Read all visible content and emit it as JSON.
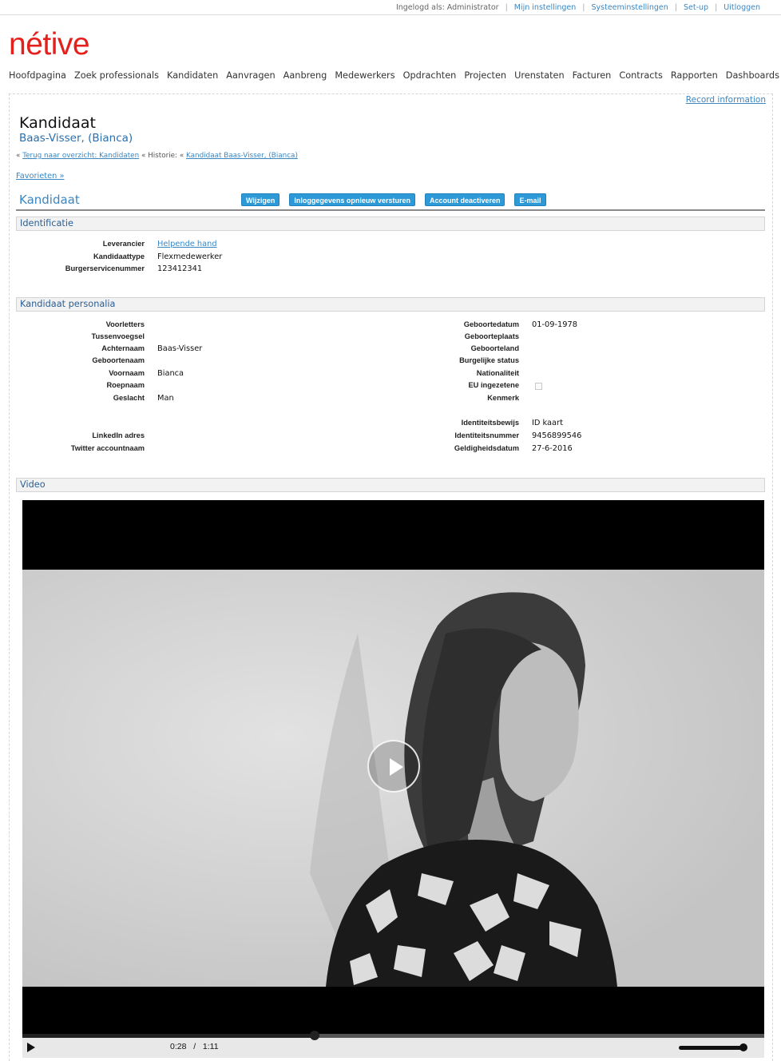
{
  "topbar": {
    "login_text": "Ingelogd als: Administrator",
    "links": [
      "Mijn instellingen",
      "Systeeminstellingen",
      "Set-up",
      "Uitloggen"
    ]
  },
  "logo": "nétive",
  "nav": [
    "Hoofdpagina",
    "Zoek professionals",
    "Kandidaten",
    "Aanvragen",
    "Aanbreng",
    "Medewerkers",
    "Opdrachten",
    "Projecten",
    "Urenstaten",
    "Facturen",
    "Contracts",
    "Rapporten",
    "Dashboards"
  ],
  "record_information": "Record information",
  "page": {
    "title": "Kandidaat",
    "subtitle": "Baas-Visser, (Bianca)"
  },
  "breadcrumb": {
    "prefix": "«",
    "back_link": "Terug naar overzicht: Kandidaten",
    "middle": "« Historie: «",
    "history_link": "Kandidaat Baas-Visser, (Bianca)"
  },
  "favorites": "Favorieten »",
  "section": {
    "title": "Kandidaat",
    "buttons": [
      "Wijzigen",
      "Inloggegevens opnieuw versturen",
      "Account deactiveren",
      "E-mail"
    ]
  },
  "identificatie": {
    "title": "Identificatie",
    "fields": [
      {
        "label": "Leverancier",
        "value": "Helpende hand"
      },
      {
        "label": "Kandidaattype",
        "value": "Flexmedewerker"
      },
      {
        "label": "Burgerservicenummer",
        "value": "123412341"
      }
    ]
  },
  "personalia": {
    "title": "Kandidaat personalia",
    "left": [
      {
        "label": "Voorletters",
        "value": ""
      },
      {
        "label": "Tussenvoegsel",
        "value": ""
      },
      {
        "label": "Achternaam",
        "value": "Baas-Visser"
      },
      {
        "label": "Geboortenaam",
        "value": ""
      },
      {
        "label": "Voornaam",
        "value": "Bianca"
      },
      {
        "label": "Roepnaam",
        "value": ""
      },
      {
        "label": "Geslacht",
        "value": "Man"
      },
      {
        "label": "LinkedIn adres",
        "value": ""
      },
      {
        "label": "Twitter accountnaam",
        "value": ""
      }
    ],
    "right": [
      {
        "label": "Geboortedatum",
        "value": "01-09-1978"
      },
      {
        "label": "Geboorteplaats",
        "value": ""
      },
      {
        "label": "Geboorteland",
        "value": ""
      },
      {
        "label": "Burgelijke status",
        "value": ""
      },
      {
        "label": "Nationaliteit",
        "value": ""
      },
      {
        "label": "EU ingezetene",
        "value": ""
      },
      {
        "label": "Kenmerk",
        "value": ""
      },
      {
        "label": "Identiteitsbewijs",
        "value": "ID kaart"
      },
      {
        "label": "Identiteitsnummer",
        "value": "9456899546"
      },
      {
        "label": "Geldigheidsdatum",
        "value": "27-6-2016"
      }
    ]
  },
  "video": {
    "title": "Video",
    "current_time": "0:28",
    "separator": "/",
    "duration": "1:11",
    "progress_fraction": 0.394,
    "volume_fraction": 0.97
  }
}
